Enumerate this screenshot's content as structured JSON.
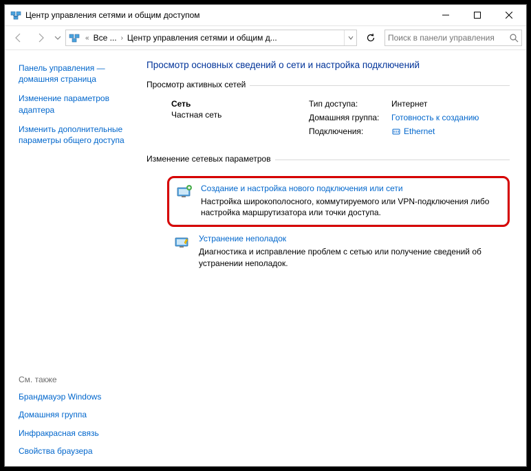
{
  "titlebar": {
    "title": "Центр управления сетями и общим доступом"
  },
  "breadcrumb": {
    "sep1": "«",
    "crumb1": "Все ...",
    "sep2": "›",
    "crumb2": "Центр управления сетями и общим д..."
  },
  "search": {
    "placeholder": "Поиск в панели управления"
  },
  "sidebar": {
    "home": "Панель управления — домашняя страница",
    "adapter": "Изменение параметров адаптера",
    "sharing": "Изменить дополнительные параметры общего доступа"
  },
  "see_also": {
    "title": "См. также",
    "firewall": "Брандмауэр Windows",
    "homegroup": "Домашняя группа",
    "infrared": "Инфракрасная связь",
    "browser": "Свойства браузера"
  },
  "main": {
    "heading": "Просмотр основных сведений о сети и настройка подключений",
    "active_title": "Просмотр активных сетей",
    "net": {
      "name": "Сеть",
      "type": "Частная сеть",
      "k1": "Тип доступа:",
      "v1": "Интернет",
      "k2": "Домашняя группа:",
      "v2": "Готовность к созданию",
      "k3": "Подключения:",
      "v3": "Ethernet"
    },
    "change_title": "Изменение сетевых параметров",
    "task1": {
      "title": "Создание и настройка нового подключения или сети",
      "desc": "Настройка широкополосного, коммутируемого или VPN-подключения либо настройка маршрутизатора или точки доступа."
    },
    "task2": {
      "title": "Устранение неполадок",
      "desc": "Диагностика и исправление проблем с сетью или получение сведений об устранении неполадок."
    }
  }
}
